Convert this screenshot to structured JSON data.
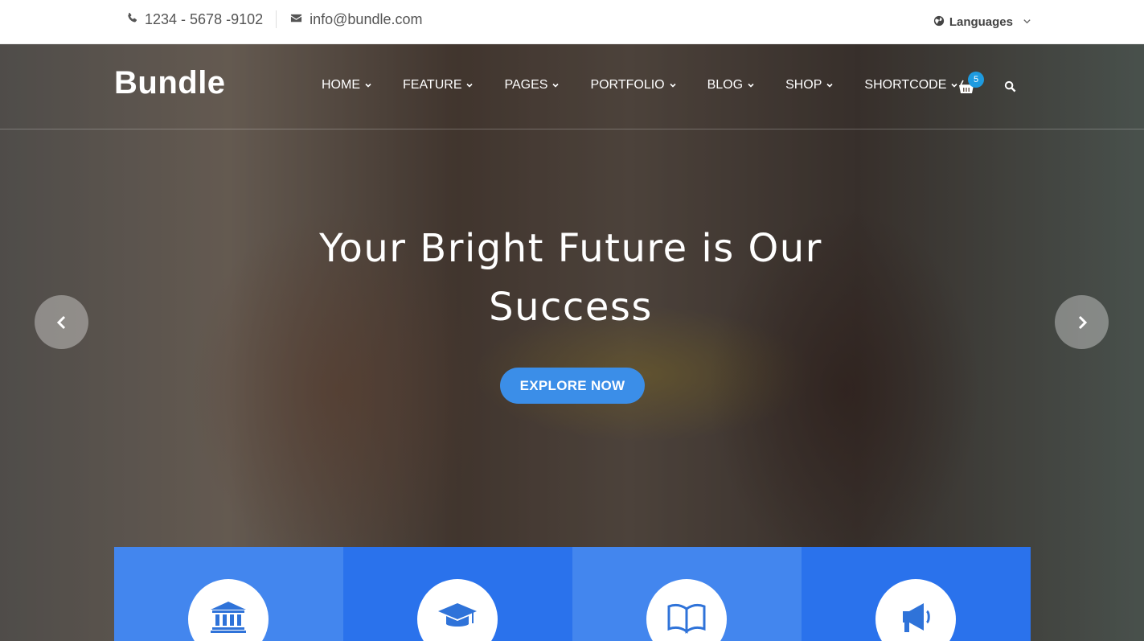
{
  "topbar": {
    "phone": "1234 - 5678 -9102",
    "email": "info@bundle.com",
    "language_label": "Languages",
    "icons": [
      "phone-icon",
      "envelope-icon",
      "globe-icon",
      "chevron-down-icon"
    ]
  },
  "nav": {
    "logo": "Bundle",
    "items": [
      {
        "label": "HOME"
      },
      {
        "label": "FEATURE"
      },
      {
        "label": "PAGES"
      },
      {
        "label": "PORTFOLIO"
      },
      {
        "label": "BLOG"
      },
      {
        "label": "SHOP"
      },
      {
        "label": "SHORTCODE"
      }
    ],
    "cart_count": "5"
  },
  "hero": {
    "headline_line1": "Your Bright Future is Our",
    "headline_line2": "Success",
    "cta": "EXPLORE NOW"
  },
  "features": [
    {
      "icon": "institution-icon",
      "color": "#4386ee"
    },
    {
      "icon": "graduation-cap-icon",
      "color": "#2a72ec"
    },
    {
      "icon": "book-icon",
      "color": "#4386ee"
    },
    {
      "icon": "megaphone-icon",
      "color": "#2a72ec"
    }
  ],
  "colors": {
    "accent": "#3b8ee8",
    "badge": "#1e9be0",
    "feature_light": "#4386ee",
    "feature_dark": "#2a72ec",
    "icon_blue": "#2f73d9"
  }
}
